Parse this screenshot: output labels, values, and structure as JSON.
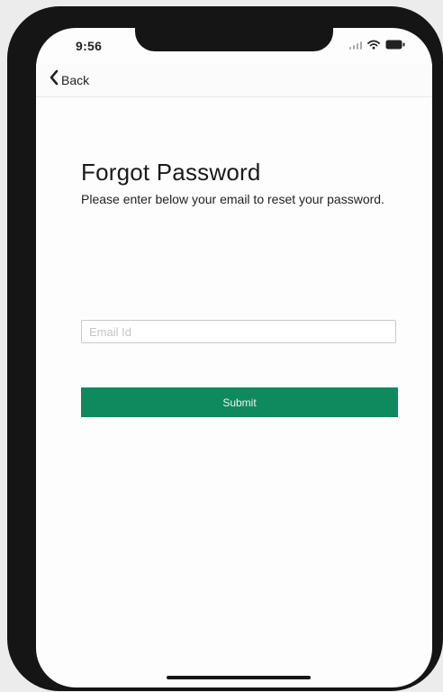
{
  "status_bar": {
    "time": "9:56",
    "icons": [
      "signal-icon",
      "wifi-icon",
      "battery-icon"
    ]
  },
  "nav": {
    "back_label": "Back",
    "back_icon": "chevron-left-icon"
  },
  "main": {
    "title": "Forgot Password",
    "subtitle": "Please enter below your email to reset your password.",
    "email": {
      "placeholder": "Email Id",
      "value": ""
    },
    "submit_label": "Submit"
  },
  "colors": {
    "accent": "#0f8a5f",
    "device_frame": "#151515",
    "background": "#fdfdfd"
  }
}
